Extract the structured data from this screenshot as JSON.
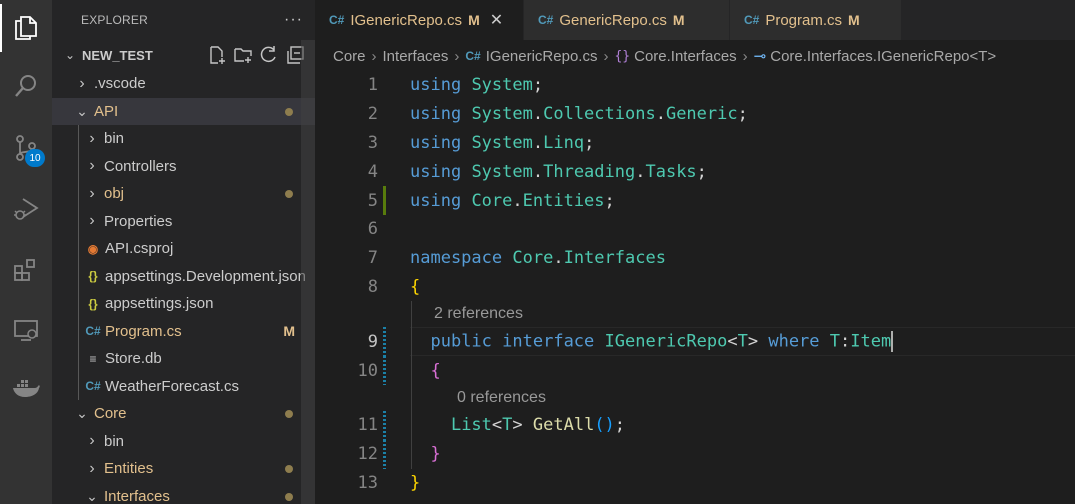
{
  "activity_bar": {
    "items": [
      {
        "icon": "explorer-icon"
      },
      {
        "icon": "search-icon"
      },
      {
        "icon": "source-control-icon",
        "badge": "10"
      },
      {
        "icon": "run-debug-icon"
      },
      {
        "icon": "extensions-icon"
      },
      {
        "icon": "remote-explorer-icon"
      },
      {
        "icon": "docker-icon"
      }
    ]
  },
  "sidebar": {
    "title": "EXPLORER",
    "more": "···",
    "project": "NEW_TEST",
    "tree": [
      {
        "label": ".vscode",
        "kind": "folder",
        "open": false,
        "depth": 1
      },
      {
        "label": "API",
        "kind": "folder",
        "open": true,
        "depth": 1,
        "modified_dot": true
      },
      {
        "label": "bin",
        "kind": "folder",
        "open": false,
        "depth": 2
      },
      {
        "label": "Controllers",
        "kind": "folder",
        "open": false,
        "depth": 2
      },
      {
        "label": "obj",
        "kind": "folder",
        "open": false,
        "depth": 2,
        "modified_dot": true
      },
      {
        "label": "Properties",
        "kind": "folder",
        "open": false,
        "depth": 2
      },
      {
        "label": "API.csproj",
        "kind": "rss",
        "depth": 2
      },
      {
        "label": "appsettings.Development.json",
        "kind": "json",
        "depth": 2
      },
      {
        "label": "appsettings.json",
        "kind": "json",
        "depth": 2
      },
      {
        "label": "Program.cs",
        "kind": "cs",
        "depth": 2,
        "status": "M"
      },
      {
        "label": "Store.db",
        "kind": "db",
        "depth": 2
      },
      {
        "label": "WeatherForecast.cs",
        "kind": "cs",
        "depth": 2
      },
      {
        "label": "Core",
        "kind": "folder",
        "open": true,
        "depth": 1,
        "modified_dot": true
      },
      {
        "label": "bin",
        "kind": "folder",
        "open": false,
        "depth": 2
      },
      {
        "label": "Entities",
        "kind": "folder",
        "open": false,
        "depth": 2,
        "modified_dot": true
      },
      {
        "label": "Interfaces",
        "kind": "folder",
        "open": true,
        "depth": 2,
        "modified_dot": true
      }
    ]
  },
  "tabs": [
    {
      "label": "IGenericRepo.cs",
      "status": "M",
      "active": true
    },
    {
      "label": "GenericRepo.cs",
      "status": "M",
      "active": false
    },
    {
      "label": "Program.cs",
      "status": "M",
      "active": false
    }
  ],
  "breadcrumb": [
    "Core",
    "Interfaces",
    "IGenericRepo.cs",
    "Core.Interfaces",
    "Core.Interfaces.IGenericRepo<T>"
  ],
  "code": {
    "lines": [
      {
        "num": "1",
        "gutter": "",
        "tokens": [
          [
            "kw",
            "using"
          ],
          [
            "pl",
            " "
          ],
          [
            "ns",
            "System"
          ],
          [
            "pl",
            ";"
          ]
        ]
      },
      {
        "num": "2",
        "gutter": "",
        "tokens": [
          [
            "kw",
            "using"
          ],
          [
            "pl",
            " "
          ],
          [
            "ns",
            "System"
          ],
          [
            "pl",
            "."
          ],
          [
            "ns",
            "Collections"
          ],
          [
            "pl",
            "."
          ],
          [
            "ns",
            "Generic"
          ],
          [
            "pl",
            ";"
          ]
        ]
      },
      {
        "num": "3",
        "gutter": "",
        "tokens": [
          [
            "kw",
            "using"
          ],
          [
            "pl",
            " "
          ],
          [
            "ns",
            "System"
          ],
          [
            "pl",
            "."
          ],
          [
            "ns",
            "Linq"
          ],
          [
            "pl",
            ";"
          ]
        ]
      },
      {
        "num": "4",
        "gutter": "",
        "tokens": [
          [
            "kw",
            "using"
          ],
          [
            "pl",
            " "
          ],
          [
            "ns",
            "System"
          ],
          [
            "pl",
            "."
          ],
          [
            "ns",
            "Threading"
          ],
          [
            "pl",
            "."
          ],
          [
            "ns",
            "Tasks"
          ],
          [
            "pl",
            ";"
          ]
        ]
      },
      {
        "num": "5",
        "gutter": "added",
        "tokens": [
          [
            "kw",
            "using"
          ],
          [
            "pl",
            " "
          ],
          [
            "ns",
            "Core"
          ],
          [
            "pl",
            "."
          ],
          [
            "ns",
            "Entities"
          ],
          [
            "pl",
            ";"
          ]
        ]
      },
      {
        "num": "6",
        "gutter": "",
        "tokens": []
      },
      {
        "num": "7",
        "gutter": "",
        "tokens": [
          [
            "kw",
            "namespace"
          ],
          [
            "pl",
            " "
          ],
          [
            "ns",
            "Core"
          ],
          [
            "pl",
            "."
          ],
          [
            "ns",
            "Interfaces"
          ]
        ]
      },
      {
        "num": "8",
        "gutter": "",
        "tokens": [
          [
            "br1",
            "{"
          ]
        ]
      },
      {
        "lens": "2 references",
        "indent": 1
      },
      {
        "num": "9",
        "gutter": "mod",
        "current": true,
        "tokens": [
          [
            "pl",
            "  "
          ],
          [
            "kw",
            "public"
          ],
          [
            "pl",
            " "
          ],
          [
            "kw",
            "interface"
          ],
          [
            "pl",
            " "
          ],
          [
            "ty",
            "IGenericRepo"
          ],
          [
            "pl",
            "<"
          ],
          [
            "ty",
            "T"
          ],
          [
            "pl",
            "> "
          ],
          [
            "kw",
            "where"
          ],
          [
            "pl",
            " "
          ],
          [
            "ty",
            "T"
          ],
          [
            "pl",
            ":"
          ],
          [
            "ty",
            "Item"
          ]
        ]
      },
      {
        "num": "10",
        "gutter": "mod",
        "tokens": [
          [
            "pl",
            "  "
          ],
          [
            "br2",
            "{"
          ]
        ]
      },
      {
        "lens": "0 references",
        "indent": 2
      },
      {
        "num": "11",
        "gutter": "mod",
        "tokens": [
          [
            "pl",
            "    "
          ],
          [
            "ty",
            "List"
          ],
          [
            "pl",
            "<"
          ],
          [
            "ty",
            "T"
          ],
          [
            "pl",
            "> "
          ],
          [
            "fn",
            "GetAll"
          ],
          [
            "br3",
            "()"
          ],
          [
            "pl",
            ";"
          ]
        ]
      },
      {
        "num": "12",
        "gutter": "mod",
        "tokens": [
          [
            "pl",
            "  "
          ],
          [
            "br2",
            "}"
          ]
        ]
      },
      {
        "num": "13",
        "gutter": "",
        "tokens": [
          [
            "br1",
            "}"
          ]
        ]
      }
    ]
  },
  "colors": {
    "keyword": "#569cd6",
    "type": "#4ec9b0",
    "function": "#dcdcaa",
    "modified": "#e2c08d",
    "accent": "#007acc"
  }
}
